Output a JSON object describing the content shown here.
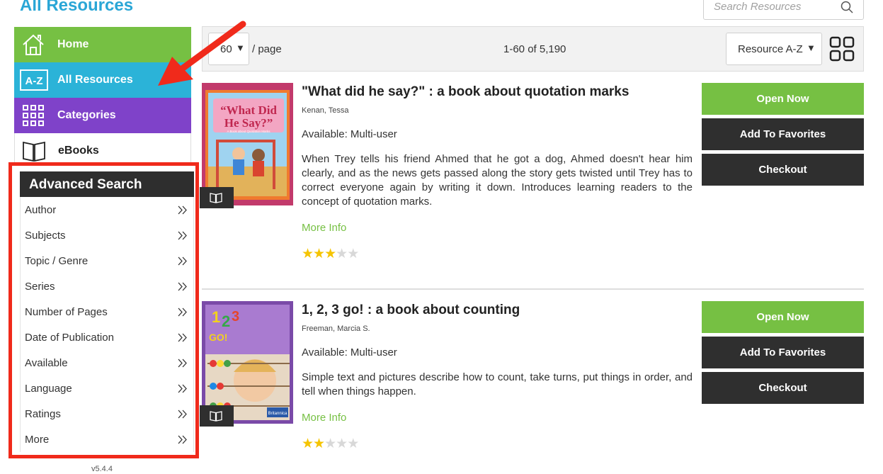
{
  "page": {
    "title": "All Resources",
    "version": "v5.4.4"
  },
  "search": {
    "placeholder": "Search Resources"
  },
  "nav": [
    {
      "label": "Home",
      "icon": "home-icon",
      "color": "#76c043"
    },
    {
      "label": "All Resources",
      "icon": "az-icon",
      "icon_text": "A-Z",
      "color": "#2bb3d8"
    },
    {
      "label": "Categories",
      "icon": "grid-categories-icon",
      "color": "#7f42c9"
    },
    {
      "label": "eBooks",
      "icon": "book-icon",
      "color": "#ffffff"
    }
  ],
  "advanced_search": {
    "title": "Advanced Search",
    "items": [
      "Author",
      "Subjects",
      "Topic / Genre",
      "Series",
      "Number of Pages",
      "Date of Publication",
      "Available",
      "Language",
      "Ratings",
      "More"
    ]
  },
  "toolbar": {
    "per_page_value": "60",
    "per_page_label": "/ page",
    "result_count": "1-60 of 5,190",
    "sort_value": "Resource A-Z"
  },
  "results": [
    {
      "title": "\"What did he say?\" : a book about quotation marks",
      "author": "Kenan, Tessa",
      "availability": "Available: Multi-user",
      "description": "When Trey tells his friend Ahmed that he got a dog, Ahmed doesn't hear him clearly, and as the news gets passed along the story gets twisted until Trey has to correct everyone again by writing it down. Introduces learning readers to the concept of quotation marks.",
      "more_info": "More Info",
      "rating": 3,
      "cover_text": [
        "“What Did",
        "He Say?”",
        "A Book about Quotation Marks"
      ]
    },
    {
      "title": "1, 2, 3 go! : a book about counting",
      "author": "Freeman, Marcia S.",
      "availability": "Available: Multi-user",
      "description": "Simple text and pictures describe how to count, take turns, put things in order, and tell when things happen.",
      "more_info": "More Info",
      "rating": 2,
      "cover_text": [
        "1",
        "2",
        "3",
        "GO!",
        "Britannica"
      ]
    }
  ],
  "buttons": {
    "open": "Open Now",
    "favorites": "Add To Favorites",
    "checkout": "Checkout"
  },
  "colors": {
    "accent_green": "#76c043",
    "accent_blue": "#2bb3d8",
    "accent_purple": "#7f42c9",
    "annotation_red": "#f02a1b",
    "dark": "#2f2f2f",
    "star": "#f5c400"
  }
}
